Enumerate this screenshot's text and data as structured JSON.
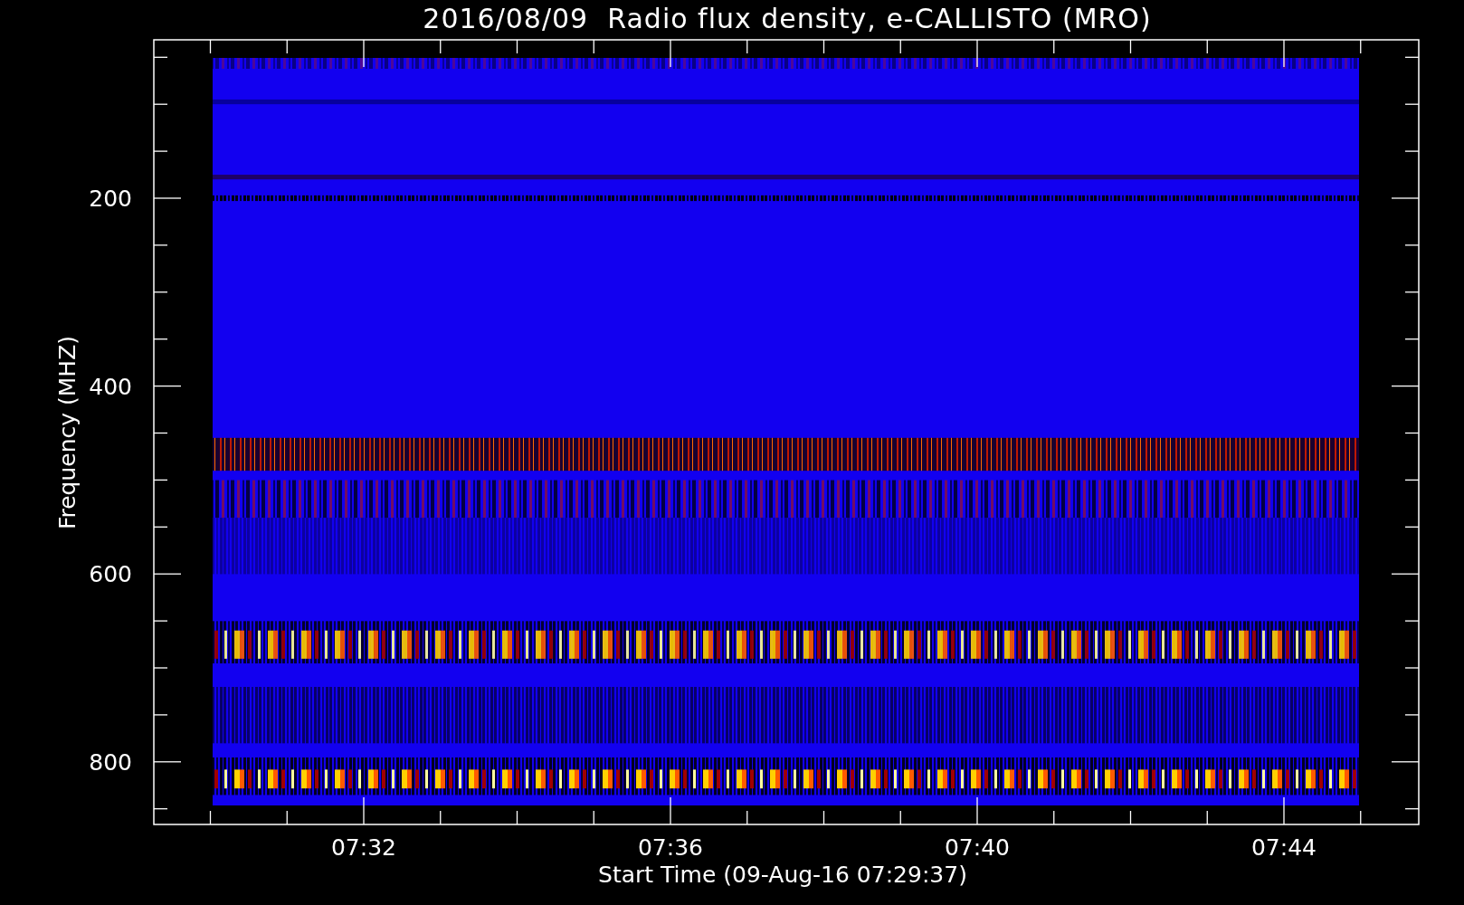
{
  "title": "2016/08/09  Radio flux density, e-CALLISTO (MRO)",
  "y_axis": {
    "label": "Frequency (MHZ)",
    "ticks": [
      "200",
      "400",
      "600",
      "800"
    ]
  },
  "x_axis": {
    "label": "Start Time (09-Aug-16 07:29:37)",
    "ticks": [
      "07:32",
      "07:36",
      "07:40",
      "07:44"
    ]
  }
}
